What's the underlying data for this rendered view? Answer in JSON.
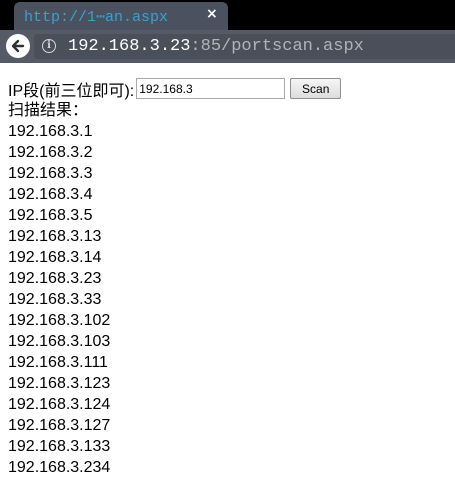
{
  "browser": {
    "tab_title": "http://1⋯an.aspx",
    "tab_close": "×",
    "url_host": "192.168.3.23",
    "url_rest": ":85/portscan.aspx",
    "info_glyph": "i"
  },
  "form": {
    "ip_label": "IP段(前三位即可):",
    "ip_value": "192.168.3",
    "scan_label": "Scan"
  },
  "results": {
    "label": "扫描结果：",
    "ips": [
      "192.168.3.1",
      "192.168.3.2",
      "192.168.3.3",
      "192.168.3.4",
      "192.168.3.5",
      "192.168.3.13",
      "192.168.3.14",
      "192.168.3.23",
      "192.168.3.33",
      "192.168.3.102",
      "192.168.3.103",
      "192.168.3.111",
      "192.168.3.123",
      "192.168.3.124",
      "192.168.3.127",
      "192.168.3.133",
      "192.168.3.234"
    ]
  },
  "colors": {
    "chrome_bg": "#000000",
    "tab_bg": "#4a5260",
    "tab_text": "#3aa0d0",
    "toolbar_bg": "#555b66"
  },
  "icons": {
    "back": "back-arrow-icon",
    "info": "info-icon",
    "close": "close-icon"
  }
}
